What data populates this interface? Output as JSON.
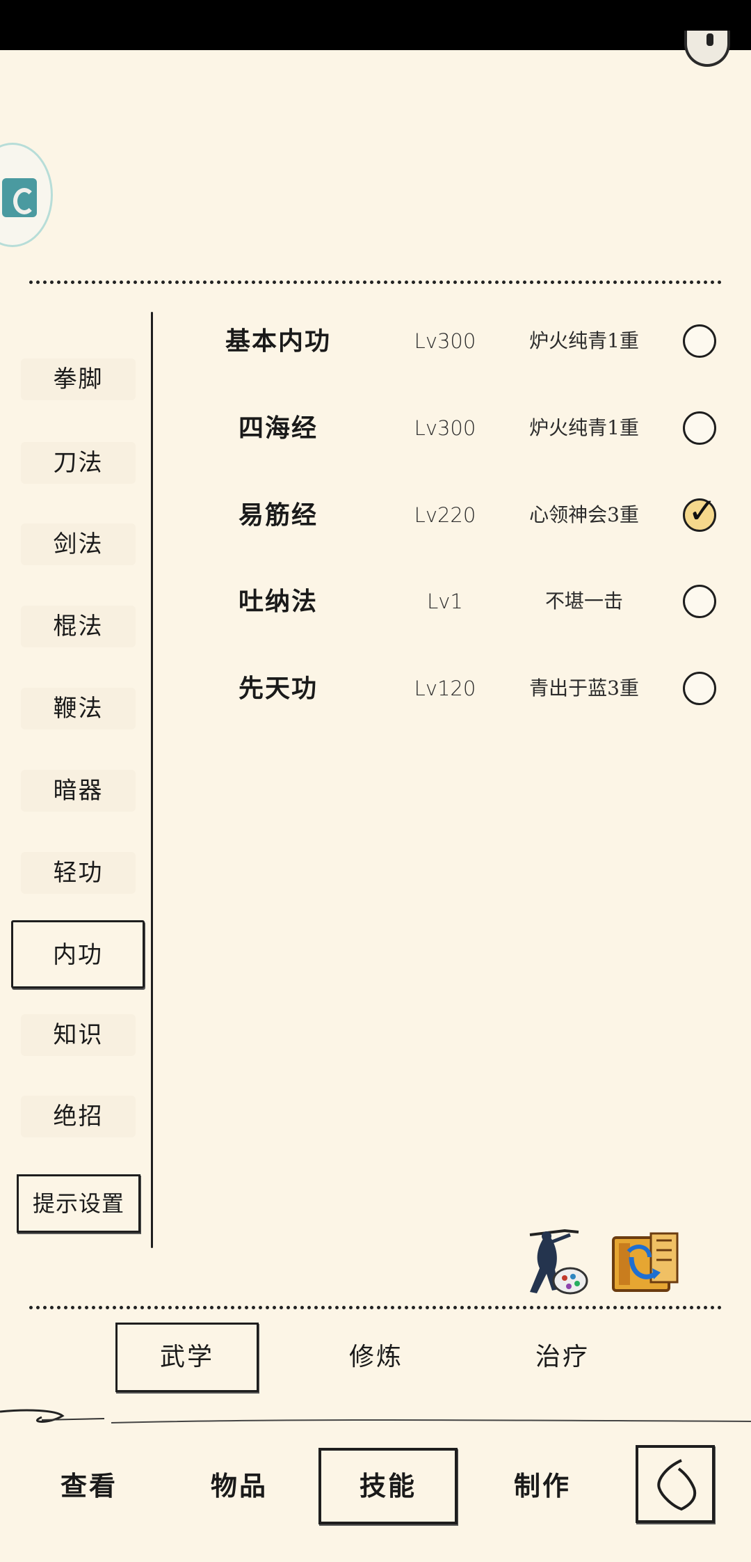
{
  "categories": [
    {
      "label": "拳脚",
      "active": false
    },
    {
      "label": "刀法",
      "active": false
    },
    {
      "label": "剑法",
      "active": false
    },
    {
      "label": "棍法",
      "active": false
    },
    {
      "label": "鞭法",
      "active": false
    },
    {
      "label": "暗器",
      "active": false
    },
    {
      "label": "轻功",
      "active": false
    },
    {
      "label": "内功",
      "active": true
    },
    {
      "label": "知识",
      "active": false
    },
    {
      "label": "绝招",
      "active": false
    }
  ],
  "hint_settings_label": "提示设置",
  "skills": [
    {
      "name": "基本内功",
      "level": "Lv300",
      "tier": "炉火纯青1重",
      "checked": false
    },
    {
      "name": "四海经",
      "level": "Lv300",
      "tier": "炉火纯青1重",
      "checked": false
    },
    {
      "name": "易筋经",
      "level": "Lv220",
      "tier": "心领神会3重",
      "checked": true
    },
    {
      "name": "吐纳法",
      "level": "Lv1",
      "tier": "不堪一击",
      "checked": false
    },
    {
      "name": "先天功",
      "level": "Lv120",
      "tier": "青出于蓝3重",
      "checked": false
    }
  ],
  "subtabs": [
    {
      "label": "武学",
      "active": true
    },
    {
      "label": "修炼",
      "active": false
    },
    {
      "label": "治疗",
      "active": false
    }
  ],
  "bottom_nav": [
    {
      "label": "查看",
      "active": false
    },
    {
      "label": "物品",
      "active": false
    },
    {
      "label": "技能",
      "active": true
    },
    {
      "label": "制作",
      "active": false
    }
  ],
  "icons": {
    "corner": "headphone-icon",
    "avatar": "app-badge-icon",
    "tool_figure": "swordsman-palette-icon",
    "tool_book": "book-swap-icon",
    "back": "back-arrow-icon"
  },
  "colors": {
    "background": "#fcf5e6",
    "ink": "#1e1e1e",
    "check_fill": "#f5d88c",
    "avatar_accent": "#4a9aa0"
  }
}
